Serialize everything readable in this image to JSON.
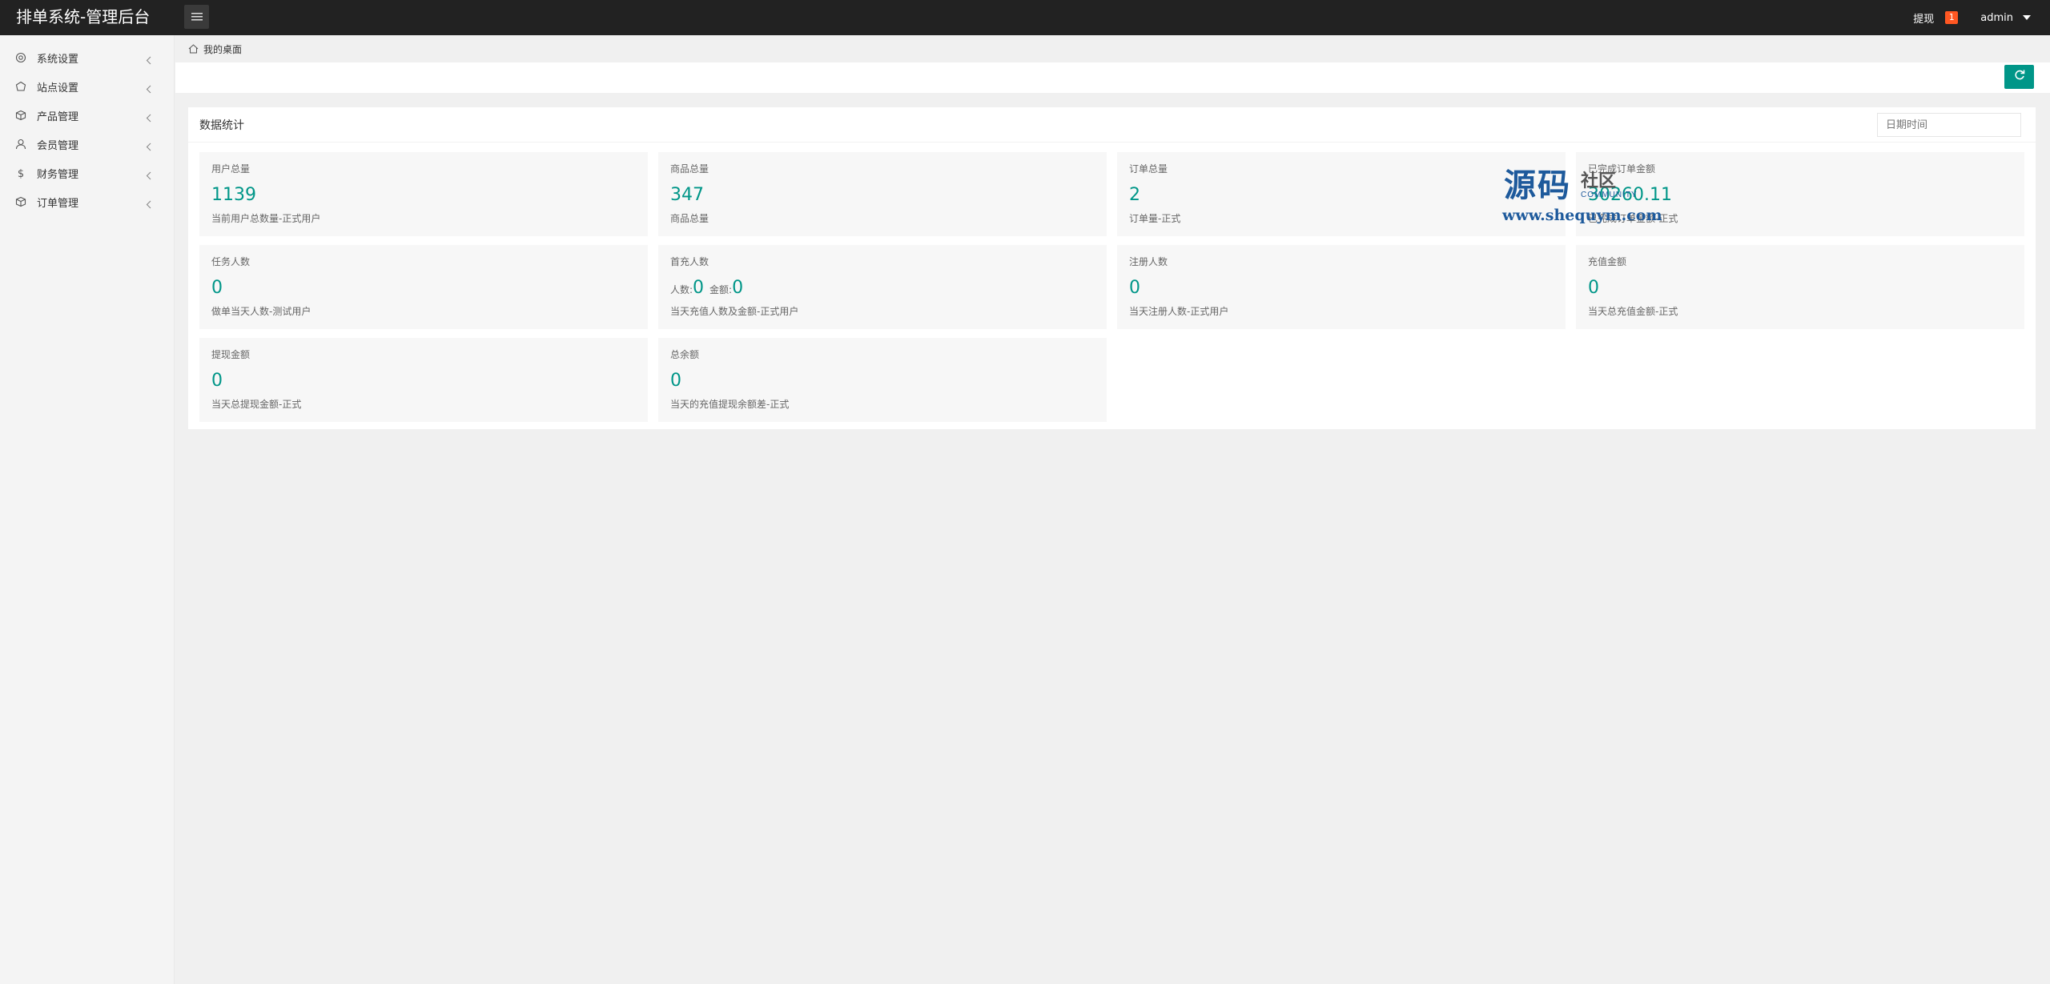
{
  "header": {
    "title": "排单系统-管理后台",
    "withdraw_label": "提现",
    "withdraw_badge": "1",
    "user_label": "admin"
  },
  "sidebar": {
    "items": [
      {
        "label": "系统设置",
        "icon": "gear-icon"
      },
      {
        "label": "站点设置",
        "icon": "site-icon"
      },
      {
        "label": "产品管理",
        "icon": "box-icon"
      },
      {
        "label": "会员管理",
        "icon": "user-icon"
      },
      {
        "label": "财务管理",
        "icon": "dollar-icon"
      },
      {
        "label": "订单管理",
        "icon": "order-icon"
      }
    ]
  },
  "breadcrumb": {
    "label": "我的桌面"
  },
  "stats": {
    "title": "数据统计",
    "date_placeholder": "日期时间",
    "tiles": [
      {
        "title": "用户总量",
        "value": "1139",
        "desc": "当前用户总数量-正式用户"
      },
      {
        "title": "商品总量",
        "value": "347",
        "desc": "商品总量"
      },
      {
        "title": "订单总量",
        "value": "2",
        "desc": "订单量-正式"
      },
      {
        "title": "已完成订单金额",
        "value": "30260.11",
        "desc": "已完成订单金额-正式"
      },
      {
        "title": "任务人数",
        "value": "0",
        "desc": "做单当天人数-测试用户"
      },
      {
        "title": "首充人数",
        "count_label": "人数:",
        "count_value": "0",
        "amount_label": "金额:",
        "amount_value": "0",
        "desc": "当天充值人数及金额-正式用户"
      },
      {
        "title": "注册人数",
        "value": "0",
        "desc": "当天注册人数-正式用户"
      },
      {
        "title": "充值金额",
        "value": "0",
        "desc": "当天总充值金额-正式"
      },
      {
        "title": "提现金额",
        "value": "0",
        "desc": "当天总提现金额-正式"
      },
      {
        "title": "总余额",
        "value": "0",
        "desc": "当天的充值提现余额差-正式"
      }
    ]
  },
  "watermark": {
    "big": "源码",
    "small": "社区",
    "sub": "COMMUNITY",
    "url": "www.shequym.com"
  },
  "colors": {
    "accent": "#009688",
    "header_bg": "#222222",
    "badge": "#ff5722"
  }
}
